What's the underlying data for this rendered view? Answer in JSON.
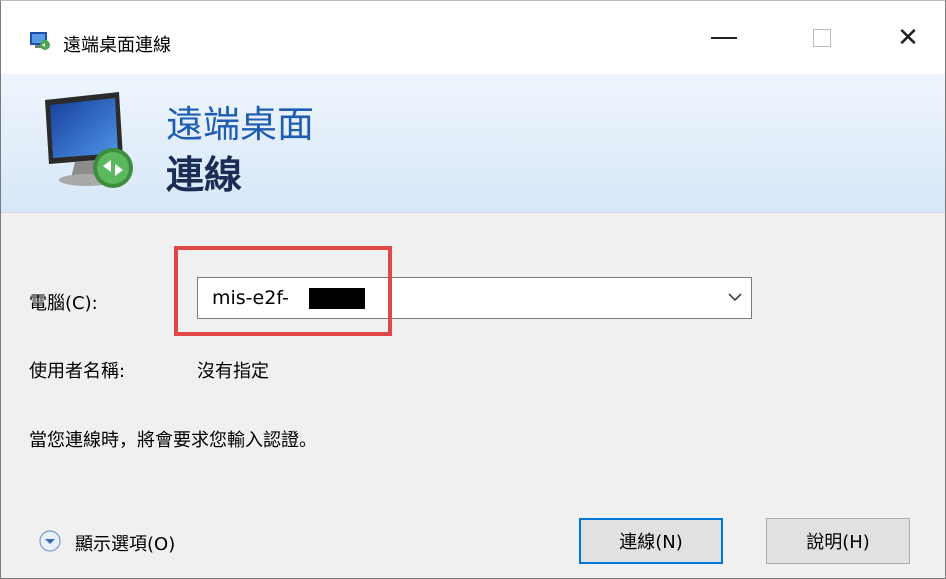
{
  "window": {
    "title": "遠端桌面連線",
    "icons": {
      "app": "remote-desktop-icon",
      "minimize": "minimize-icon",
      "maximize": "maximize-icon",
      "close": "close-icon"
    },
    "close_glyph": "✕"
  },
  "banner": {
    "line1": "遠端桌面",
    "line2": "連線",
    "icon": "monitor-remote-icon"
  },
  "form": {
    "computer_label": "電腦(C):",
    "computer_value": "mis-e2f-",
    "username_label": "使用者名稱:",
    "username_value": "沒有指定",
    "info_text": "當您連線時，將會要求您輸入認證。"
  },
  "footer": {
    "show_options_label": "顯示選項(O)",
    "connect_label": "連線(N)",
    "help_label": "說明(H)"
  },
  "colors": {
    "highlight_border": "#e04747",
    "banner_title": "#1e5db0",
    "default_button_border": "#0078d7"
  }
}
